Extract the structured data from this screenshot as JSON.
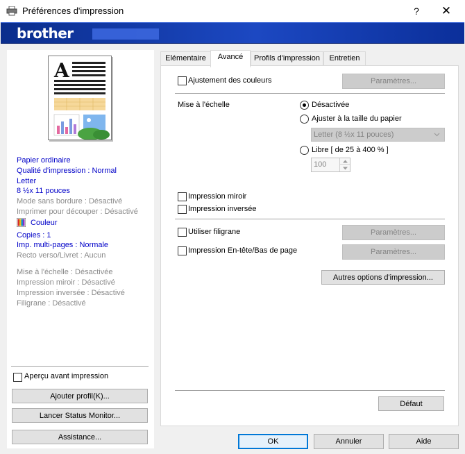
{
  "window": {
    "title": "Préférences d'impression",
    "help": "?",
    "close": "✕"
  },
  "brand": {
    "logo": "brother"
  },
  "summary": {
    "items": [
      {
        "text": "Papier ordinaire",
        "style": "blue"
      },
      {
        "text": "Qualité d'impression : Normal",
        "style": "blue"
      },
      {
        "text": "Letter",
        "style": "blue"
      },
      {
        "text": "8 ½x 11 pouces",
        "style": "blue"
      },
      {
        "text": "Mode sans bordure : Désactivé",
        "style": "grey"
      },
      {
        "text": "Imprimer pour découper : Désactivé",
        "style": "grey"
      }
    ],
    "color_label": "Couleur",
    "items2": [
      {
        "text": "Copies : 1",
        "style": "blue"
      },
      {
        "text": "Imp. multi-pages : Normale",
        "style": "blue"
      },
      {
        "text": "Recto verso/Livret : Aucun",
        "style": "grey"
      }
    ],
    "items3": [
      {
        "text": "Mise à l'échelle : Désactivée",
        "style": "grey"
      },
      {
        "text": "Impression miroir : Désactivé",
        "style": "grey"
      },
      {
        "text": "Impression inversée : Désactivé",
        "style": "grey"
      },
      {
        "text": "Filigrane : Désactivé",
        "style": "grey"
      }
    ]
  },
  "left": {
    "preview_checkbox": "Aperçu avant impression",
    "add_profile": "Ajouter profil(K)...",
    "status_monitor": "Lancer Status Monitor...",
    "support": "Assistance..."
  },
  "tabs": [
    {
      "label": "Elémentaire",
      "active": false
    },
    {
      "label": "Avancé",
      "active": true
    },
    {
      "label": "Profils d'impression",
      "active": false
    },
    {
      "label": "Entretien",
      "active": false
    }
  ],
  "advanced": {
    "color_adjust": {
      "label": "Ajustement des couleurs",
      "checked": false,
      "button": "Paramètres..."
    },
    "scaling": {
      "label": "Mise à l'échelle",
      "off": "Désactivée",
      "fit": "Ajuster à la taille du papier",
      "fit_select": "Letter (8 ½x 11 pouces)",
      "free": "Libre [ de 25 à 400 % ]",
      "free_value": "100",
      "selected": "off"
    },
    "mirror": {
      "label": "Impression miroir",
      "checked": false
    },
    "reverse": {
      "label": "Impression inversée",
      "checked": false
    },
    "watermark": {
      "label": "Utiliser filigrane",
      "checked": false,
      "button": "Paramètres..."
    },
    "header_footer": {
      "label": "Impression En-tête/Bas de page",
      "checked": false,
      "button": "Paramètres..."
    },
    "other_options": "Autres options d'impression...",
    "default": "Défaut"
  },
  "footer": {
    "ok": "OK",
    "cancel": "Annuler",
    "help": "Aide"
  },
  "colors": {
    "brand_blue": "#1c48c2",
    "link_blue": "#0000c8",
    "focus_blue": "#0078d7"
  }
}
